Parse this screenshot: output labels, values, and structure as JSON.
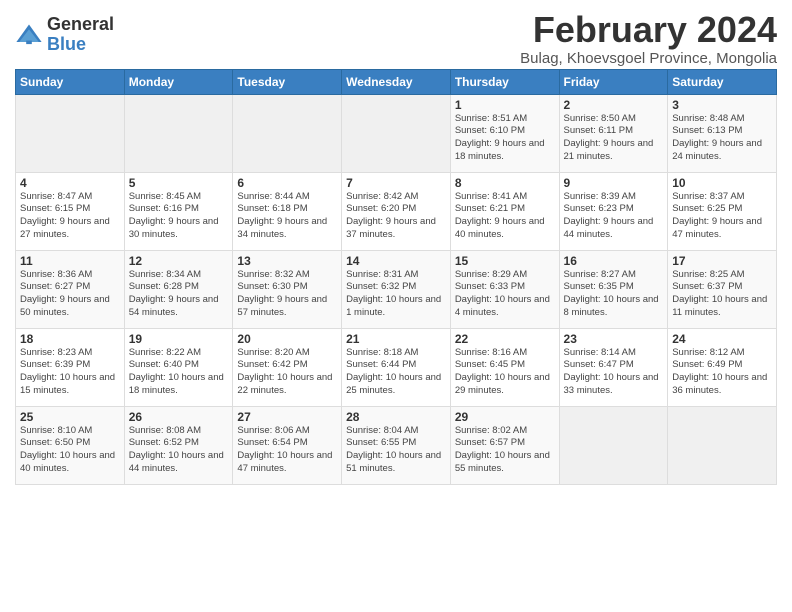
{
  "logo": {
    "general": "General",
    "blue": "Blue"
  },
  "title": "February 2024",
  "subtitle": "Bulag, Khoevsgoel Province, Mongolia",
  "days_of_week": [
    "Sunday",
    "Monday",
    "Tuesday",
    "Wednesday",
    "Thursday",
    "Friday",
    "Saturday"
  ],
  "weeks": [
    [
      {
        "day": "",
        "info": ""
      },
      {
        "day": "",
        "info": ""
      },
      {
        "day": "",
        "info": ""
      },
      {
        "day": "",
        "info": ""
      },
      {
        "day": "1",
        "info": "Sunrise: 8:51 AM\nSunset: 6:10 PM\nDaylight: 9 hours and 18 minutes."
      },
      {
        "day": "2",
        "info": "Sunrise: 8:50 AM\nSunset: 6:11 PM\nDaylight: 9 hours and 21 minutes."
      },
      {
        "day": "3",
        "info": "Sunrise: 8:48 AM\nSunset: 6:13 PM\nDaylight: 9 hours and 24 minutes."
      }
    ],
    [
      {
        "day": "4",
        "info": "Sunrise: 8:47 AM\nSunset: 6:15 PM\nDaylight: 9 hours and 27 minutes."
      },
      {
        "day": "5",
        "info": "Sunrise: 8:45 AM\nSunset: 6:16 PM\nDaylight: 9 hours and 30 minutes."
      },
      {
        "day": "6",
        "info": "Sunrise: 8:44 AM\nSunset: 6:18 PM\nDaylight: 9 hours and 34 minutes."
      },
      {
        "day": "7",
        "info": "Sunrise: 8:42 AM\nSunset: 6:20 PM\nDaylight: 9 hours and 37 minutes."
      },
      {
        "day": "8",
        "info": "Sunrise: 8:41 AM\nSunset: 6:21 PM\nDaylight: 9 hours and 40 minutes."
      },
      {
        "day": "9",
        "info": "Sunrise: 8:39 AM\nSunset: 6:23 PM\nDaylight: 9 hours and 44 minutes."
      },
      {
        "day": "10",
        "info": "Sunrise: 8:37 AM\nSunset: 6:25 PM\nDaylight: 9 hours and 47 minutes."
      }
    ],
    [
      {
        "day": "11",
        "info": "Sunrise: 8:36 AM\nSunset: 6:27 PM\nDaylight: 9 hours and 50 minutes."
      },
      {
        "day": "12",
        "info": "Sunrise: 8:34 AM\nSunset: 6:28 PM\nDaylight: 9 hours and 54 minutes."
      },
      {
        "day": "13",
        "info": "Sunrise: 8:32 AM\nSunset: 6:30 PM\nDaylight: 9 hours and 57 minutes."
      },
      {
        "day": "14",
        "info": "Sunrise: 8:31 AM\nSunset: 6:32 PM\nDaylight: 10 hours and 1 minute."
      },
      {
        "day": "15",
        "info": "Sunrise: 8:29 AM\nSunset: 6:33 PM\nDaylight: 10 hours and 4 minutes."
      },
      {
        "day": "16",
        "info": "Sunrise: 8:27 AM\nSunset: 6:35 PM\nDaylight: 10 hours and 8 minutes."
      },
      {
        "day": "17",
        "info": "Sunrise: 8:25 AM\nSunset: 6:37 PM\nDaylight: 10 hours and 11 minutes."
      }
    ],
    [
      {
        "day": "18",
        "info": "Sunrise: 8:23 AM\nSunset: 6:39 PM\nDaylight: 10 hours and 15 minutes."
      },
      {
        "day": "19",
        "info": "Sunrise: 8:22 AM\nSunset: 6:40 PM\nDaylight: 10 hours and 18 minutes."
      },
      {
        "day": "20",
        "info": "Sunrise: 8:20 AM\nSunset: 6:42 PM\nDaylight: 10 hours and 22 minutes."
      },
      {
        "day": "21",
        "info": "Sunrise: 8:18 AM\nSunset: 6:44 PM\nDaylight: 10 hours and 25 minutes."
      },
      {
        "day": "22",
        "info": "Sunrise: 8:16 AM\nSunset: 6:45 PM\nDaylight: 10 hours and 29 minutes."
      },
      {
        "day": "23",
        "info": "Sunrise: 8:14 AM\nSunset: 6:47 PM\nDaylight: 10 hours and 33 minutes."
      },
      {
        "day": "24",
        "info": "Sunrise: 8:12 AM\nSunset: 6:49 PM\nDaylight: 10 hours and 36 minutes."
      }
    ],
    [
      {
        "day": "25",
        "info": "Sunrise: 8:10 AM\nSunset: 6:50 PM\nDaylight: 10 hours and 40 minutes."
      },
      {
        "day": "26",
        "info": "Sunrise: 8:08 AM\nSunset: 6:52 PM\nDaylight: 10 hours and 44 minutes."
      },
      {
        "day": "27",
        "info": "Sunrise: 8:06 AM\nSunset: 6:54 PM\nDaylight: 10 hours and 47 minutes."
      },
      {
        "day": "28",
        "info": "Sunrise: 8:04 AM\nSunset: 6:55 PM\nDaylight: 10 hours and 51 minutes."
      },
      {
        "day": "29",
        "info": "Sunrise: 8:02 AM\nSunset: 6:57 PM\nDaylight: 10 hours and 55 minutes."
      },
      {
        "day": "",
        "info": ""
      },
      {
        "day": "",
        "info": ""
      }
    ]
  ]
}
